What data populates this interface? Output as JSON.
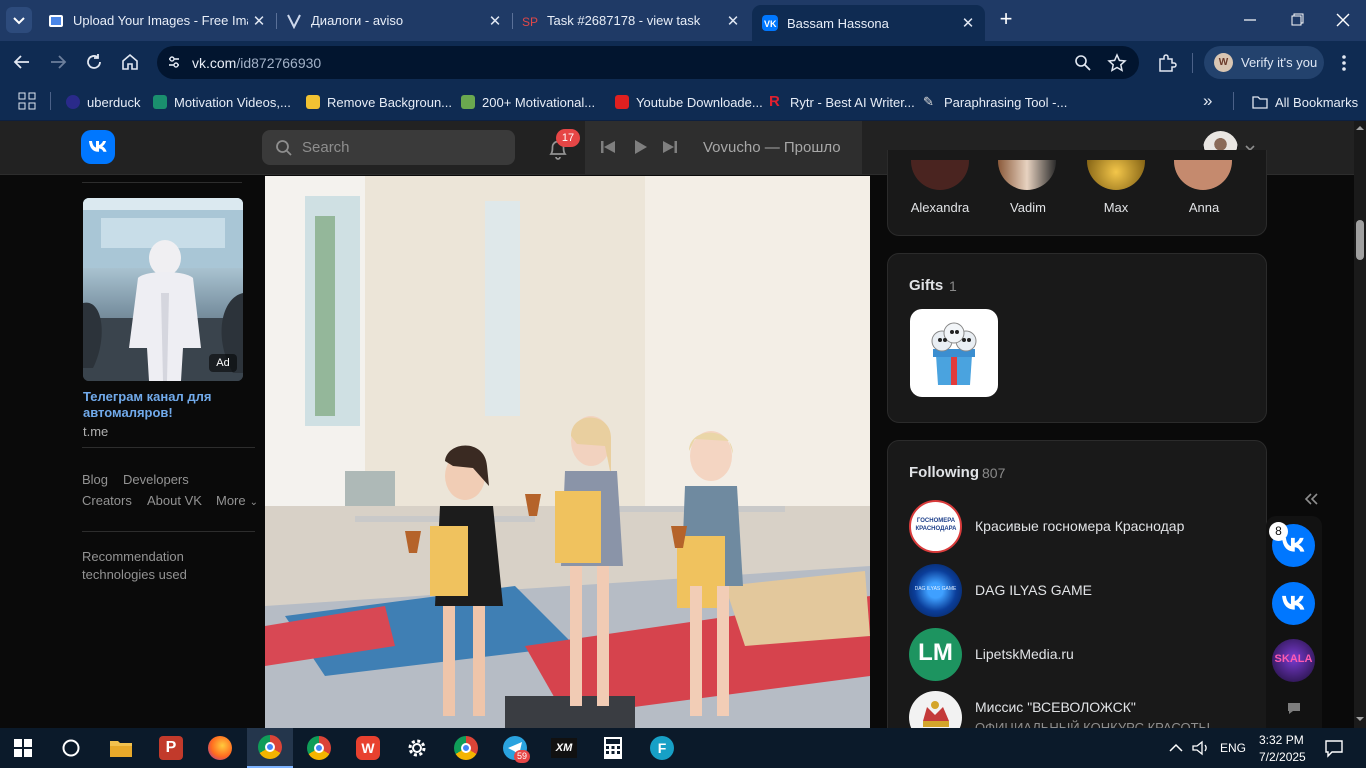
{
  "browser": {
    "tabs": [
      {
        "title": "Upload Your Images - Free Imag",
        "icon": "image-host-icon"
      },
      {
        "title": "Диалоги - aviso",
        "icon": "aviso-icon"
      },
      {
        "title": "Task #2687178 - view task",
        "icon": "sp-icon"
      },
      {
        "title": "Bassam Hassona",
        "icon": "vk-icon",
        "active": true
      }
    ],
    "url_host": "vk.com",
    "url_path": "/id872766930",
    "verify_label": "Verify it's you",
    "verify_initial": "W",
    "bookmarks": [
      {
        "label": "uberduck",
        "color": "#2a2a8a"
      },
      {
        "label": "Motivation Videos,...",
        "color": "#1a8f6e"
      },
      {
        "label": "Remove Backgroun...",
        "color": "#f1c232"
      },
      {
        "label": "200+ Motivational...",
        "color": "#6aa84f"
      },
      {
        "label": "Youtube Downloade...",
        "color": "#e02020"
      },
      {
        "label": "Rytr - Best AI Writer...",
        "color": "#e0202f"
      },
      {
        "label": "Paraphrasing Tool -...",
        "color": "#dddddd"
      }
    ],
    "all_bookmarks": "All Bookmarks"
  },
  "vk": {
    "search_placeholder": "Search",
    "notifications": "17",
    "player_track": "Vovucho — Прошло",
    "left": {
      "ad_badge": "Ad",
      "ad_title": "Телеграм канал для автомаляров!",
      "ad_domain": "t.me",
      "links": [
        "Blog",
        "Developers",
        "Creators",
        "About VK",
        "More"
      ],
      "recommendation": "Recommendation technologies used"
    },
    "friends": [
      "Alexandra",
      "Vadim",
      "Max",
      "Anna"
    ],
    "gifts": {
      "title": "Gifts",
      "count": "1"
    },
    "following": {
      "title": "Following",
      "count": "807",
      "items": [
        {
          "name": "Красивые госномера Краснодар",
          "avatar_text": "ГОСНОМЕРА\nКРАСНОДАРА"
        },
        {
          "name": "DAG ILYAS GAME",
          "avatar_text": "DAG ILYAS GAME"
        },
        {
          "name": "LipetskMedia.ru",
          "avatar_text": "LM"
        },
        {
          "name": "Миссис \"ВСЕВОЛОЖСК\"",
          "subtitle": "ОФИЦИАЛЬНЫЙ КОНКУРС КРАСОТЫ"
        }
      ]
    },
    "rail": {
      "badge": "8",
      "skala": "SKALA"
    }
  },
  "taskbar": {
    "telegram_badge": "59",
    "lang": "ENG",
    "time": "3:32 PM",
    "date": "7/2/2025"
  },
  "colors": {
    "vk_blue": "#0077ff",
    "chrome_frame": "#1f3a66",
    "chrome_toolbar": "#0f2b52",
    "badge_red": "#e64646"
  }
}
